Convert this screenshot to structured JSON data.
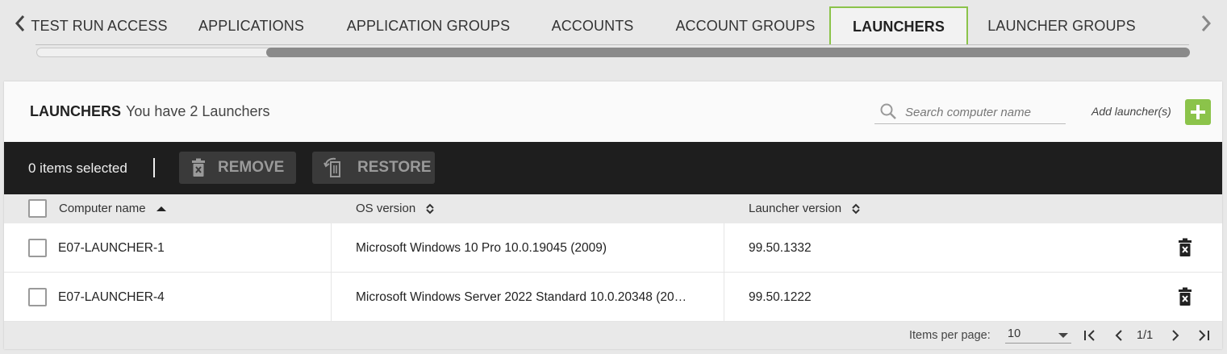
{
  "tabs": [
    {
      "label": "TEST RUN ACCESS",
      "active": false
    },
    {
      "label": "APPLICATIONS",
      "active": false
    },
    {
      "label": "APPLICATION GROUPS",
      "active": false
    },
    {
      "label": "ACCOUNTS",
      "active": false
    },
    {
      "label": "ACCOUNT GROUPS",
      "active": false
    },
    {
      "label": "LAUNCHERS",
      "active": true
    },
    {
      "label": "LAUNCHER GROUPS",
      "active": false
    }
  ],
  "header": {
    "title": "LAUNCHERS",
    "subtitle": "You have 2 Launchers",
    "search_placeholder": "Search computer name",
    "add_label": "Add launcher(s)"
  },
  "actionbar": {
    "selected_text": "0 items selected",
    "remove_label": "REMOVE",
    "restore_label": "RESTORE"
  },
  "table": {
    "columns": [
      {
        "label": "Computer name",
        "sort": "asc"
      },
      {
        "label": "OS version",
        "sort": "none"
      },
      {
        "label": "Launcher version",
        "sort": "none"
      }
    ],
    "rows": [
      {
        "computer": "E07-LAUNCHER-1",
        "os": "Microsoft Windows 10 Pro 10.0.19045 (2009)",
        "version": "99.50.1332"
      },
      {
        "computer": "E07-LAUNCHER-4",
        "os": "Microsoft Windows Server 2022 Standard 10.0.20348 (20…",
        "version": "99.50.1222"
      }
    ]
  },
  "footer": {
    "items_per_page_label": "Items per page:",
    "items_per_page_value": "10",
    "page_text": "1/1"
  },
  "colors": {
    "accent": "#8bc34a",
    "actionbar": "#1e1e1e"
  }
}
